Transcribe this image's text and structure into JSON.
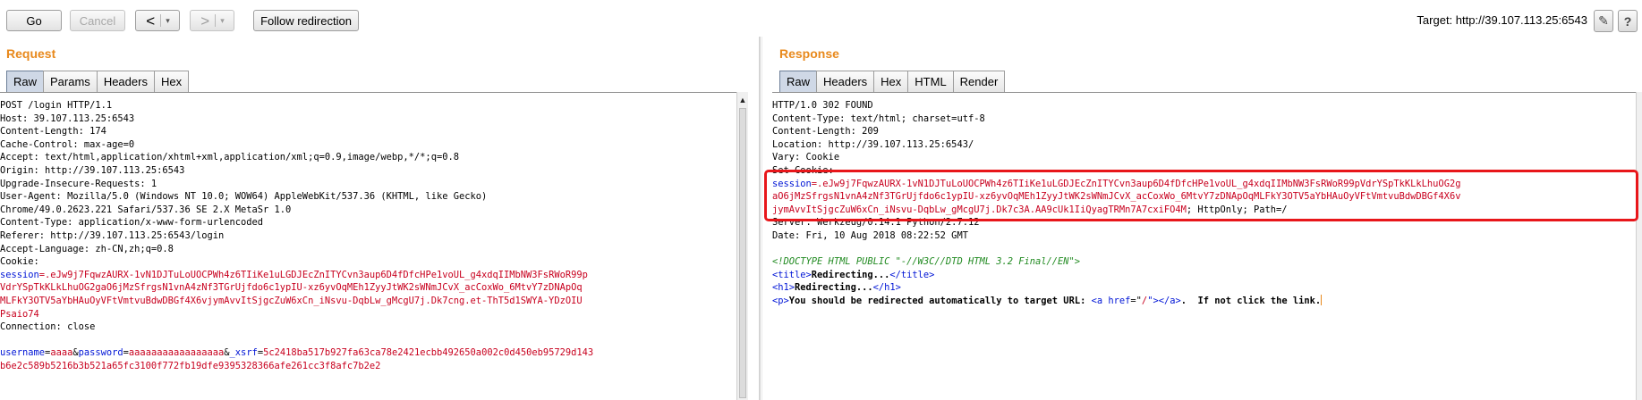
{
  "toolbar": {
    "go_label": "Go",
    "cancel_label": "Cancel",
    "back_arrow": "<",
    "forward_arrow": ">",
    "dropdown_glyph": "▾",
    "follow_label": "Follow redirection",
    "target_text": "Target: http://39.107.113.25:6543",
    "edit_icon": "✎",
    "help_icon": "?"
  },
  "request": {
    "title": "Request",
    "tabs": [
      "Raw",
      "Params",
      "Headers",
      "Hex"
    ],
    "active_tab": "Raw",
    "lines": [
      [
        {
          "t": "POST /login HTTP/1.1"
        }
      ],
      [
        {
          "t": "Host: 39.107.113.25:6543"
        }
      ],
      [
        {
          "t": "Content-Length: 174"
        }
      ],
      [
        {
          "t": "Cache-Control: max-age=0"
        }
      ],
      [
        {
          "t": "Accept: text/html,application/xhtml+xml,application/xml;q=0.9,image/webp,*/*;q=0.8"
        }
      ],
      [
        {
          "t": "Origin: http://39.107.113.25:6543"
        }
      ],
      [
        {
          "t": "Upgrade-Insecure-Requests: 1"
        }
      ],
      [
        {
          "t": "User-Agent: Mozilla/5.0 (Windows NT 10.0; WOW64) AppleWebKit/537.36 (KHTML, like Gecko)"
        }
      ],
      [
        {
          "t": "Chrome/49.0.2623.221 Safari/537.36 SE 2.X MetaSr 1.0"
        }
      ],
      [
        {
          "t": "Content-Type: application/x-www-form-urlencoded"
        }
      ],
      [
        {
          "t": "Referer: http://39.107.113.25:6543/login"
        }
      ],
      [
        {
          "t": "Accept-Language: zh-CN,zh;q=0.8"
        }
      ],
      [
        {
          "t": "Cookie:"
        }
      ],
      [
        {
          "t": "session",
          "c": "k"
        },
        {
          "t": "=.eJw9j7FqwzAURX-1vN1DJTuLoUOCPWh4z6TIiKe1uLGDJEcZnITYCvn3aup6D4fDfcHPe1voUL_g4xdqIIMbNW3FsRWoR99p",
          "c": "v"
        }
      ],
      [
        {
          "t": "VdrYSpTkKLkLhuOG2gaO6jMzSfrgsN1vnA4zNf3TGrUjfdo6c1ypIU-xz6yvOqMEh1ZyyJtWK2sWNmJCvX_acCoxWo_6MtvY7zDNApOq",
          "c": "v"
        }
      ],
      [
        {
          "t": "MLFkY3OTV5aYbHAuOyVFtVmtvuBdwDBGf4X6vjymAvvItSjgcZuW6xCn_iNsvu-DqbLw_gMcgU7j.Dk7cng.et-ThT5d1SWYA-YDzOIU",
          "c": "v"
        }
      ],
      [
        {
          "t": "Psaio74",
          "c": "v"
        }
      ],
      [
        {
          "t": "Connection: close"
        }
      ],
      [
        {
          "t": ""
        }
      ],
      [
        {
          "t": "username",
          "c": "k"
        },
        {
          "t": "="
        },
        {
          "t": "aaaa",
          "c": "v"
        },
        {
          "t": "&"
        },
        {
          "t": "password",
          "c": "k"
        },
        {
          "t": "="
        },
        {
          "t": "aaaaaaaaaaaaaaaaa",
          "c": "v"
        },
        {
          "t": "&"
        },
        {
          "t": "_xsrf",
          "c": "k"
        },
        {
          "t": "="
        },
        {
          "t": "5c2418ba517b927fa63ca78e2421ecbb492650a002c0d450eb95729d143",
          "c": "v"
        }
      ],
      [
        {
          "t": "b6e2c589b5216b3b521a65fc3100f772fb19dfe9395328366afe261cc3f8afc7b2e2",
          "c": "v"
        }
      ]
    ]
  },
  "response": {
    "title": "Response",
    "tabs": [
      "Raw",
      "Headers",
      "Hex",
      "HTML",
      "Render"
    ],
    "active_tab": "Raw",
    "lines": [
      [
        {
          "t": "HTTP/1.0 302 FOUND"
        }
      ],
      [
        {
          "t": "Content-Type: text/html; charset=utf-8"
        }
      ],
      [
        {
          "t": "Content-Length: 209"
        }
      ],
      [
        {
          "t": "Location: http://39.107.113.25:6543/"
        }
      ],
      [
        {
          "t": "Vary: Cookie"
        }
      ],
      [
        {
          "t": "Set-Cookie:"
        }
      ],
      [
        {
          "t": "session",
          "c": "k"
        },
        {
          "t": "=.eJw9j7FqwzAURX-1vN1DJTuLoUOCPWh4z6TIiKe1uLGDJEcZnITYCvn3aup6D4fDfcHPe1voUL_g4xdqIIMbNW3FsRWoR99pVdrYSpTkKLkLhuOG2g",
          "c": "v"
        }
      ],
      [
        {
          "t": "aO6jMzSfrgsN1vnA4zNf3TGrUjfdo6c1ypIU-xz6yvOqMEh1ZyyJtWK2sWNmJCvX_acCoxWo_6MtvY7zDNApOqMLFkY3OTV5aYbHAuOyVFtVmtvuBdwDBGf4X6v",
          "c": "v"
        }
      ],
      [
        {
          "t": "jymAvvItSjgcZuW6xCn_iNsvu-DqbLw_gMcgU7j.Dk7c3A.AA9cUk1IiQyagTRMn7A7cxiFO4M",
          "c": "v"
        },
        {
          "t": "; HttpOnly; Path=/"
        }
      ],
      [
        {
          "t": "Server: Werkzeug/0.14.1 Python/2.7.12"
        }
      ],
      [
        {
          "t": "Date: Fri, 10 Aug 2018 08:22:52 GMT"
        }
      ],
      [
        {
          "t": ""
        }
      ],
      [
        {
          "t": "<!DOCTYPE HTML PUBLIC \"-//W3C//DTD HTML 3.2 Final//EN\">",
          "c": "cm"
        }
      ],
      [
        {
          "t": "<title>",
          "c": "tg"
        },
        {
          "t": "Redirecting...",
          "c": "b"
        },
        {
          "t": "</title>",
          "c": "tg"
        }
      ],
      [
        {
          "t": "<h1>",
          "c": "tg"
        },
        {
          "t": "Redirecting...",
          "c": "b"
        },
        {
          "t": "</h1>",
          "c": "tg"
        }
      ],
      [
        {
          "t": "<p>",
          "c": "tg"
        },
        {
          "t": "You should be redirected automatically to target URL: ",
          "c": "b"
        },
        {
          "t": "<a ",
          "c": "tg"
        },
        {
          "t": "href",
          "c": "k"
        },
        {
          "t": "=\""
        },
        {
          "t": "/",
          "c": "v"
        },
        {
          "t": "\">",
          "c": "tg"
        },
        {
          "t": "</a>",
          "c": "tg"
        },
        {
          "t": ".  If not click the link.",
          "c": "b"
        }
      ]
    ]
  },
  "colors": {
    "accent_orange": "#e8891c",
    "highlight_red": "#e8161a",
    "param_blue": "#0015d6",
    "value_red": "#c8001e",
    "comment_green": "#228b22"
  }
}
